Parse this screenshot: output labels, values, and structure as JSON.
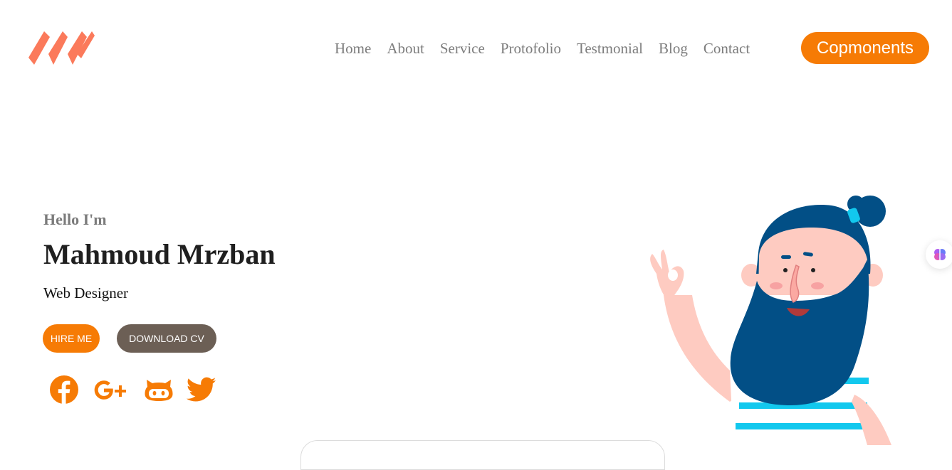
{
  "nav": {
    "items": [
      "Home",
      "About",
      "Service",
      "Protofolio",
      "Testmonial",
      "Blog",
      "Contact"
    ],
    "cta_label": "Copmonents"
  },
  "hero": {
    "greeting": "Hello I'm",
    "name": "Mahmoud Mrzban",
    "role": "Web Designer",
    "hire_label": "HIRE ME",
    "cv_label": "DOWNLOAD CV"
  },
  "social": [
    "facebook-icon",
    "google-plus-icon",
    "github-icon",
    "twitter-icon"
  ],
  "colors": {
    "accent": "#f67b05",
    "logo": "#fb7a5b",
    "secondary_button": "#6c5f55",
    "nav_text": "#7d7d7d",
    "beard": "#024f86",
    "skin": "#fecbc1",
    "stripe": "#12c8ee"
  }
}
